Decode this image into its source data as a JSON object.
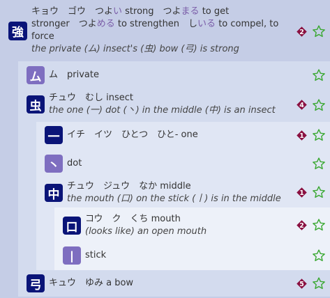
{
  "rows": [
    {
      "kanji": "強",
      "type": "kanji",
      "line1a": "キョウ　ゴウ　つよ",
      "line1b": "い",
      "line1c": " strong　つよ",
      "line1d": "まる",
      "line1e": " to get",
      "line2a": "stronger　つよ",
      "line2b": "める",
      "line2c": " to strengthen　し",
      "line2d": "いる",
      "line2e": " to compel, to",
      "line3": "force",
      "mnemonic": "the private (ム) insect's (虫) bow (弓) is strong",
      "badge": "2",
      "badge_color": "#8a1040"
    },
    {
      "kanji": "ム",
      "type": "radical",
      "text": "ム　private"
    },
    {
      "kanji": "虫",
      "type": "kanji",
      "text": "チュウ　むし insect",
      "mnemonic": "the one (一) dot (丶) in the middle (中) is an insect",
      "badge": "4",
      "badge_color": "#8a1040"
    },
    {
      "kanji": "一",
      "type": "kanji",
      "text": "イチ　イツ　ひとつ　ひと- one",
      "badge": "1",
      "badge_color": "#8a1040"
    },
    {
      "kanji": "丶",
      "type": "radical",
      "text": "dot"
    },
    {
      "kanji": "中",
      "type": "kanji",
      "text": "チュウ　ジュウ　なか middle",
      "mnemonic": "the mouth (口) on the stick (丨) is in the middle",
      "badge": "1",
      "badge_color": "#8a1040"
    },
    {
      "kanji": "口",
      "type": "kanji",
      "text": "コウ　ク　くち mouth",
      "mnemonic": "(looks like) an open mouth",
      "badge": "2",
      "badge_color": "#8a1040"
    },
    {
      "kanji": "丨",
      "type": "radical",
      "text": "stick"
    },
    {
      "kanji": "弓",
      "type": "kanji",
      "text": "キュウ　ゆみ a bow",
      "badge": "5",
      "badge_color": "#8a1040"
    }
  ],
  "colors": {
    "level0": "#c5cde6",
    "level1": "#d3dbee",
    "level2": "#e0e6f4",
    "level3": "#edf1f9",
    "kanji_box": "#0a1478",
    "radical_box": "#7e6ec0",
    "star": "#3aa832"
  },
  "icons": {
    "star": "star-outline-icon",
    "badge": "diamond-number-icon"
  }
}
